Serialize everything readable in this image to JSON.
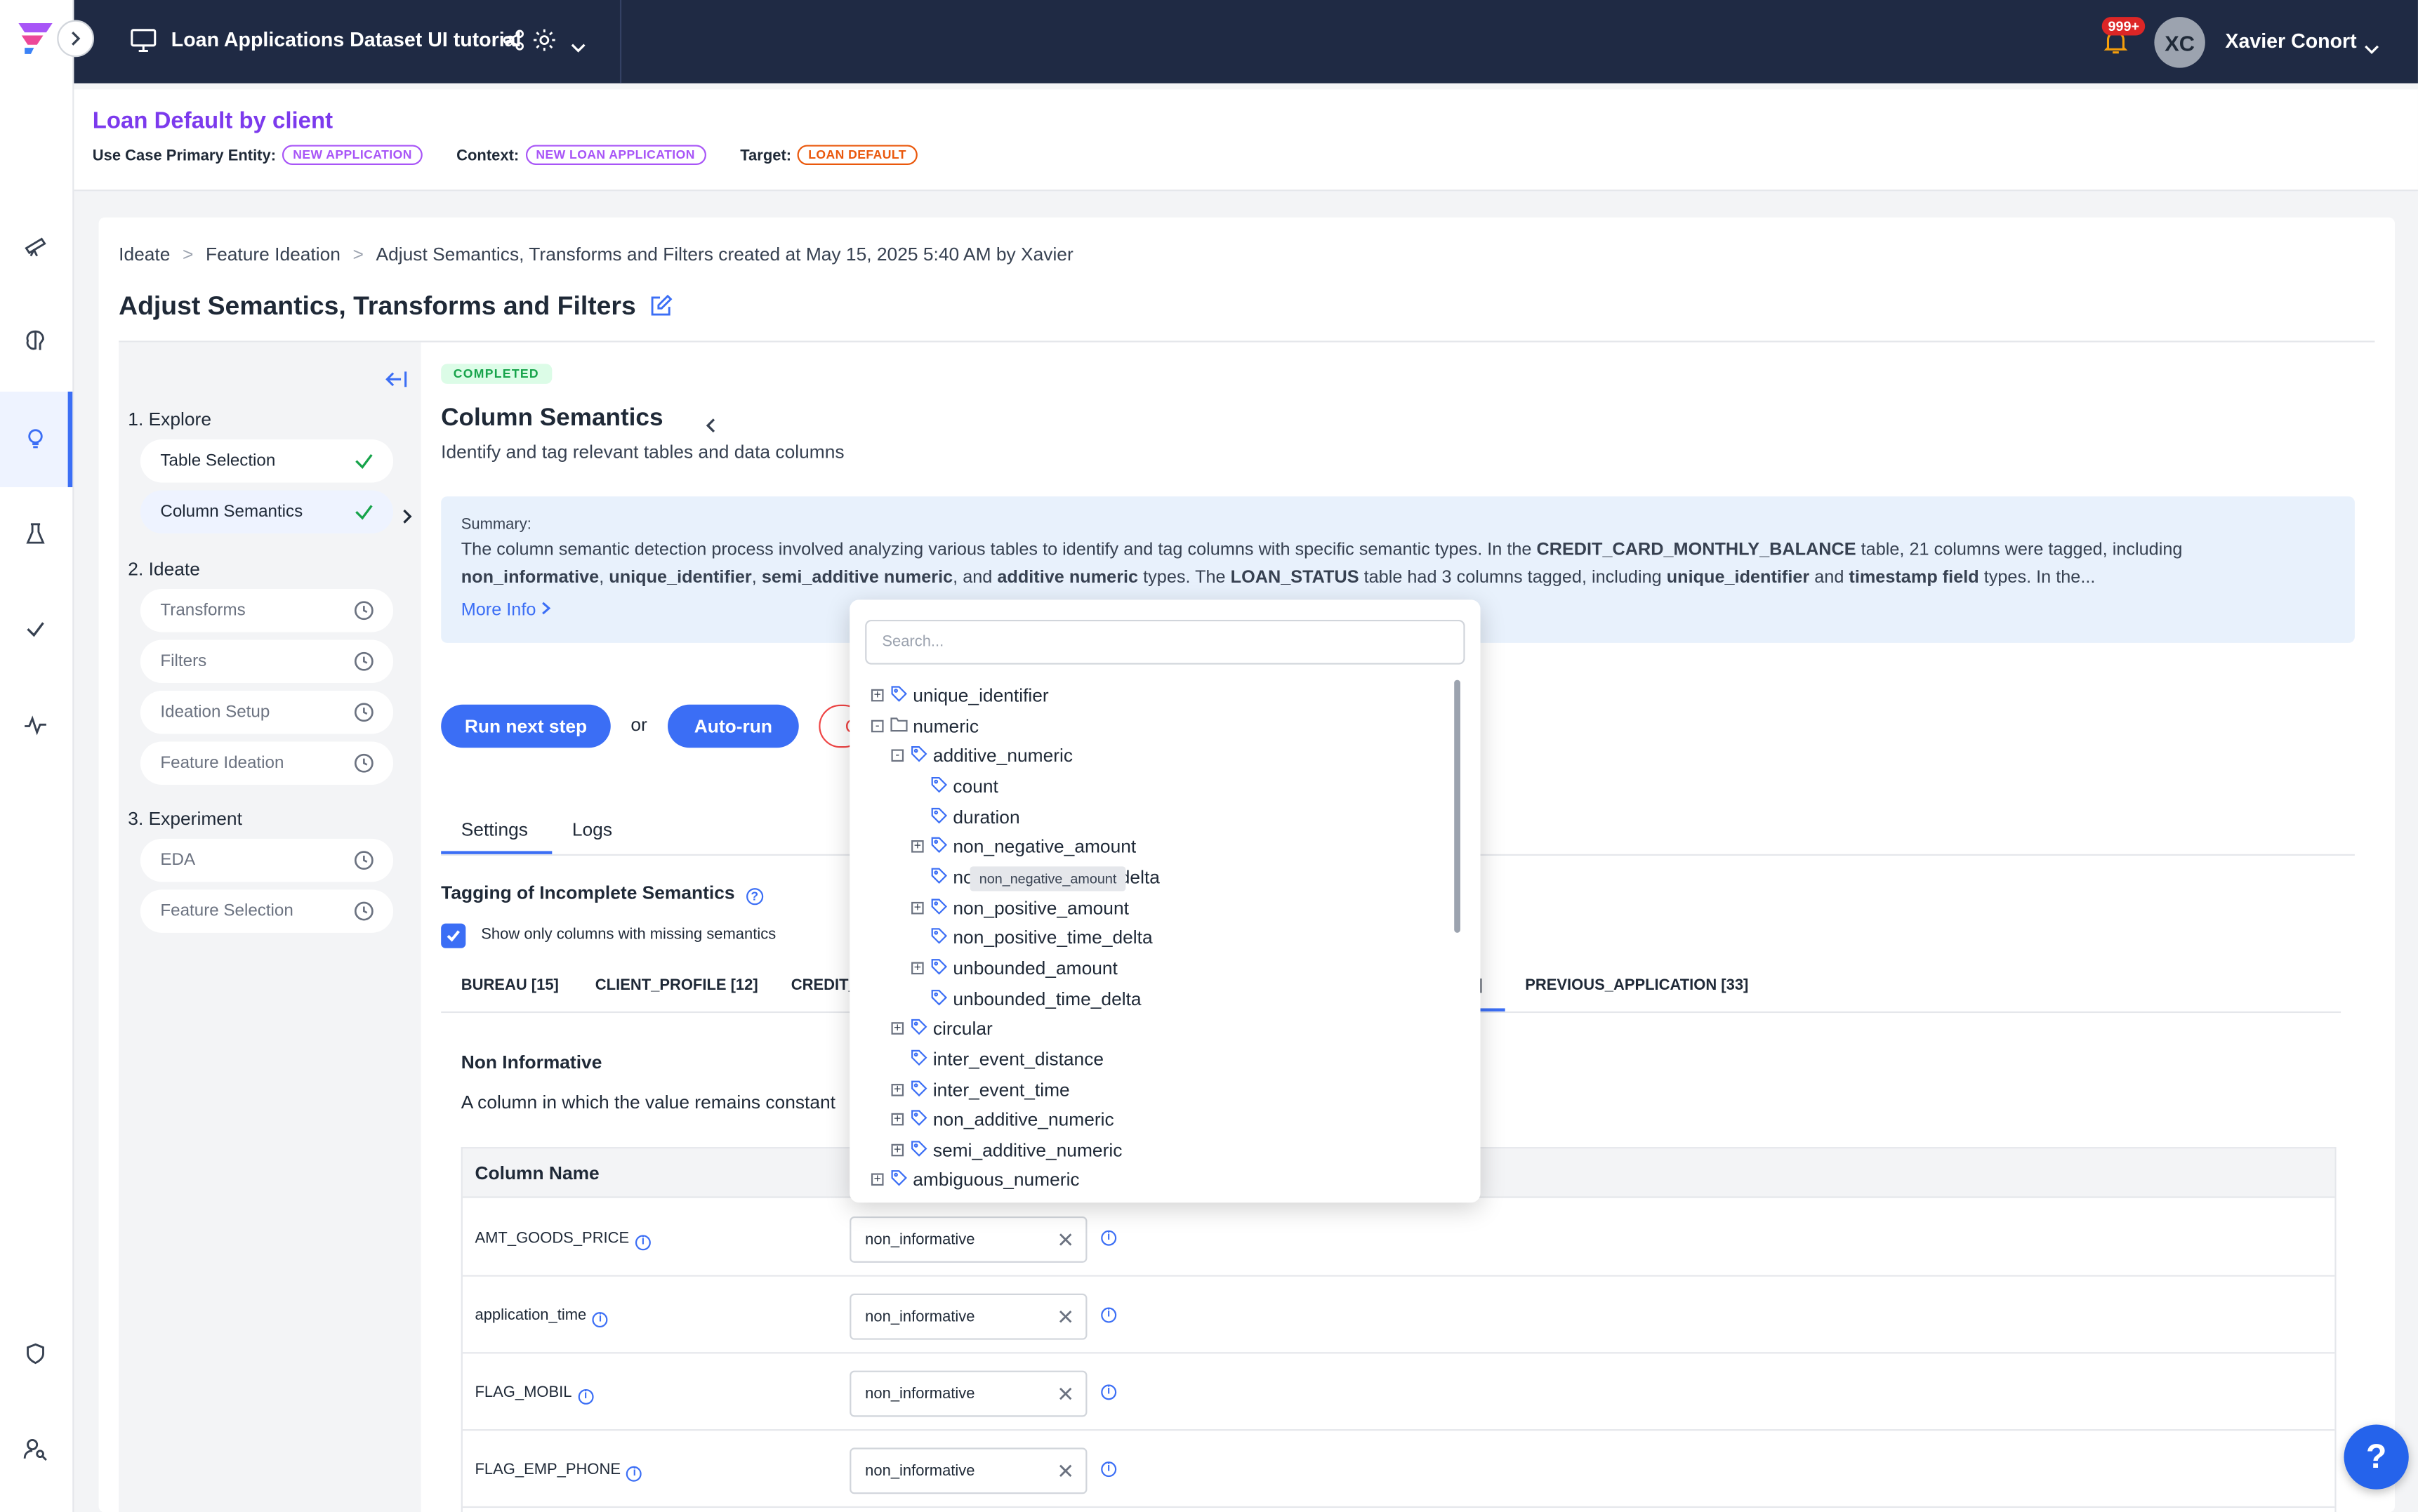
{
  "topbar": {
    "project_title": "Loan Applications Dataset UI tutorial",
    "notification_count": "999+",
    "user_initials": "XC",
    "user_name": "Xavier Conort"
  },
  "use_case": {
    "title": "Loan Default by client",
    "primary_entity_label": "Use Case Primary Entity:",
    "primary_entity_value": "NEW APPLICATION",
    "context_label": "Context:",
    "context_value": "NEW LOAN APPLICATION",
    "target_label": "Target:",
    "target_value": "LOAN DEFAULT"
  },
  "breadcrumb": {
    "items": [
      "Ideate",
      "Feature Ideation",
      "Adjust Semantics, Transforms and Filters created at May 15, 2025 5:40 AM by Xavier"
    ],
    "separator": ">"
  },
  "page": {
    "title": "Adjust Semantics, Transforms and Filters"
  },
  "stepper": {
    "sections": [
      {
        "heading": "1. Explore",
        "items": [
          {
            "label": "Table Selection",
            "status": "done"
          },
          {
            "label": "Column Semantics",
            "status": "done"
          }
        ]
      },
      {
        "heading": "2. Ideate",
        "items": [
          {
            "label": "Transforms",
            "status": "pending"
          },
          {
            "label": "Filters",
            "status": "pending"
          },
          {
            "label": "Ideation Setup",
            "status": "pending"
          },
          {
            "label": "Feature Ideation",
            "status": "pending"
          }
        ]
      },
      {
        "heading": "3. Experiment",
        "items": [
          {
            "label": "EDA",
            "status": "pending"
          },
          {
            "label": "Feature Selection",
            "status": "pending"
          }
        ]
      }
    ]
  },
  "panel": {
    "status": "COMPLETED",
    "title": "Column Semantics",
    "subtitle": "Identify and tag relevant tables and data columns",
    "summary_label": "Summary:",
    "summary_line1_a": "The column semantic detection process involved analyzing various tables to identify and tag columns with specific semantic types. In the ",
    "summary_line1_b": "CREDIT_CARD_MONTHLY_BALANCE",
    "summary_line1_c": " table, 21 columns were tagged, including",
    "summary_line2_a": "non_informative",
    "summary_line2_b": ", ",
    "summary_line2_c": "unique_identifier",
    "summary_line2_d": ", ",
    "summary_line2_e": "semi_additive numeric",
    "summary_line2_f": ", and ",
    "summary_line2_g": "additive numeric",
    "summary_line2_h": " types. The ",
    "summary_line2_i": "LOAN_STATUS",
    "summary_line2_j": " table had 3 columns tagged, including ",
    "summary_line2_k": "unique_identifier",
    "summary_line2_l": " and ",
    "summary_line2_m": "timestamp field",
    "summary_line2_n": " types. In the...",
    "more_info": "More Info",
    "run_next_label": "Run next step",
    "or_label": "or",
    "auto_run_label": "Auto-run",
    "cancel_partial": "C",
    "tabs": [
      "Settings",
      "Logs"
    ],
    "tagging_title": "Tagging of Incomplete Semantics",
    "checkbox_label": "Show only columns with missing semantics",
    "table_tabs": [
      "BUREAU [15]",
      "CLIENT_PROFILE [12]",
      "CREDIT_",
      "]",
      "PREVIOUS_APPLICATION [33]"
    ],
    "section_title": "Non Informative",
    "section_desc": "A column in which the value remains constant",
    "column_header": "Column Name",
    "rows": [
      {
        "name": "AMT_GOODS_PRICE",
        "value": "non_informative"
      },
      {
        "name": "application_time",
        "value": "non_informative"
      },
      {
        "name": "FLAG_MOBIL",
        "value": "non_informative"
      },
      {
        "name": "FLAG_EMP_PHONE",
        "value": "non_informative"
      }
    ]
  },
  "dropdown": {
    "placeholder": "Search...",
    "tree": [
      {
        "label": "unique_identifier",
        "toggle": "+",
        "icon": "tag-icon"
      },
      {
        "label": "numeric",
        "toggle": "-",
        "icon": "folder-icon"
      },
      {
        "label": "additive_numeric",
        "toggle": "-",
        "icon": "tag-icon"
      },
      {
        "label": "count",
        "toggle": "",
        "icon": "tag-icon"
      },
      {
        "label": "duration",
        "toggle": "",
        "icon": "tag-icon"
      },
      {
        "label": "non_negative_amount",
        "toggle": "+",
        "icon": "tag-icon"
      },
      {
        "label": "non_negative_time_delta",
        "toggle": "",
        "icon": "tag-icon"
      },
      {
        "label": "non_positive_amount",
        "toggle": "+",
        "icon": "tag-icon"
      },
      {
        "label": "non_positive_time_delta",
        "toggle": "",
        "icon": "tag-icon"
      },
      {
        "label": "unbounded_amount",
        "toggle": "+",
        "icon": "tag-icon"
      },
      {
        "label": "unbounded_time_delta",
        "toggle": "",
        "icon": "tag-icon"
      },
      {
        "label": "circular",
        "toggle": "+",
        "icon": "tag-icon"
      },
      {
        "label": "inter_event_distance",
        "toggle": "",
        "icon": "tag-icon"
      },
      {
        "label": "inter_event_time",
        "toggle": "+",
        "icon": "tag-icon"
      },
      {
        "label": "non_additive_numeric",
        "toggle": "+",
        "icon": "tag-icon"
      },
      {
        "label": "semi_additive_numeric",
        "toggle": "+",
        "icon": "tag-icon"
      },
      {
        "label": "ambiguous_numeric",
        "toggle": "+",
        "icon": "tag-icon"
      }
    ],
    "tooltip": "non_negative_amount"
  },
  "help": {
    "label": "?"
  },
  "colors": {
    "accent": "#3b6ef5",
    "topbar": "#1f2a44",
    "brand_purple": "#7c3aed",
    "success": "#16a34a"
  }
}
